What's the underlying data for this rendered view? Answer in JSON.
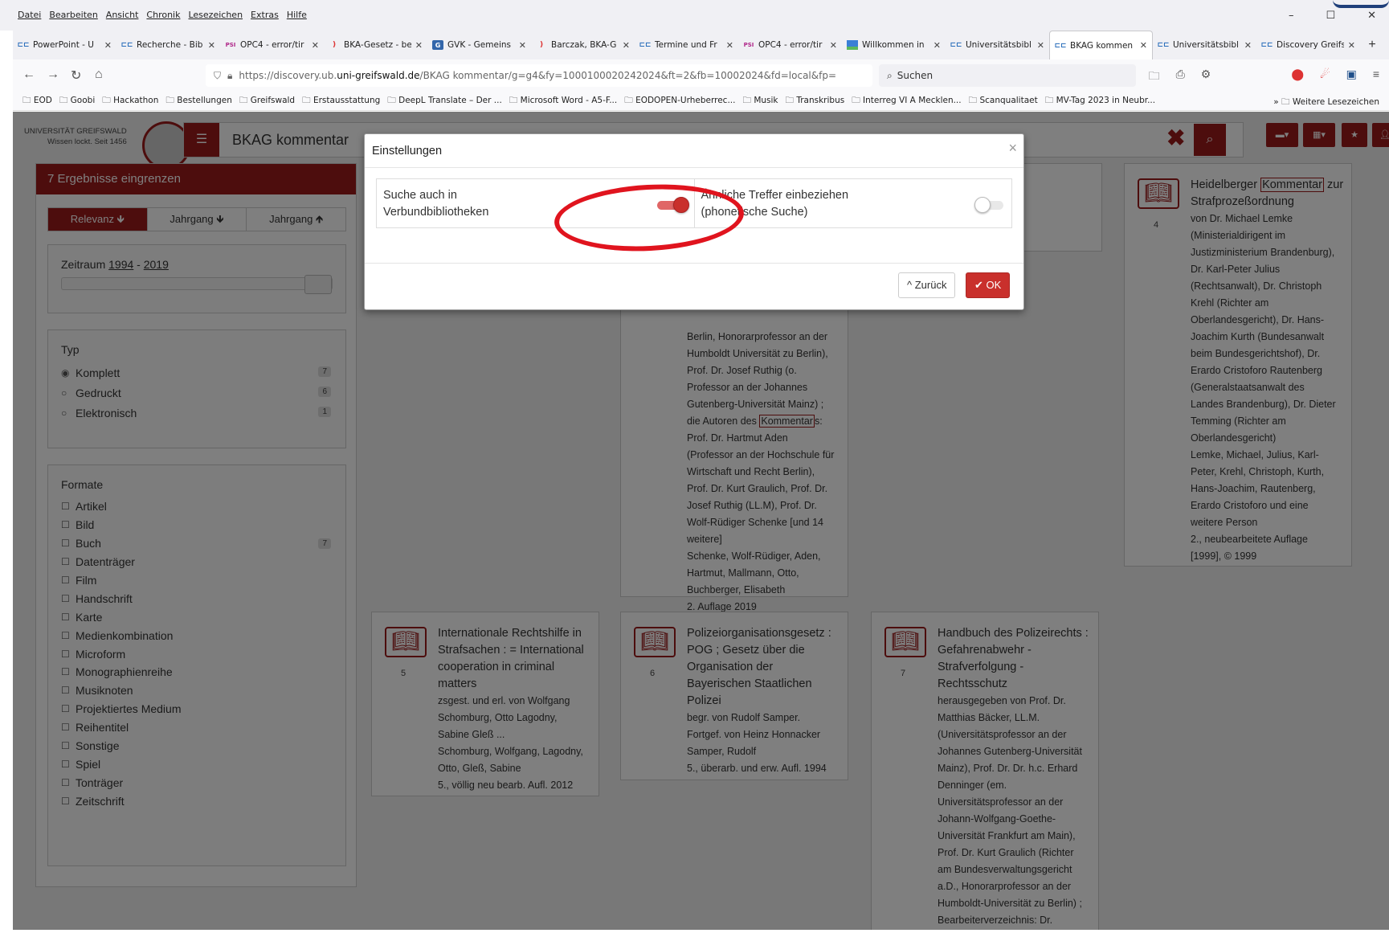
{
  "menu": [
    "Datei",
    "Bearbeiten",
    "Ansicht",
    "Chronik",
    "Lesezeichen",
    "Extras",
    "Hilfe"
  ],
  "tabs": [
    {
      "label": "PowerPoint - U",
      "icon": "ub-icon"
    },
    {
      "label": "Recherche - Bib",
      "icon": "ub-icon"
    },
    {
      "label": "OPC4 - error/tir",
      "icon": "psi-icon"
    },
    {
      "label": "BKA-Gesetz - be",
      "icon": "bookmark-red-icon"
    },
    {
      "label": "GVK - Gemeins",
      "icon": "gvk-icon"
    },
    {
      "label": "Barczak, BKA-G",
      "icon": "bookmark-red-icon"
    },
    {
      "label": "Termine und Fr",
      "icon": "ub-icon"
    },
    {
      "label": "OPC4 - error/tir",
      "icon": "psi-icon"
    },
    {
      "label": "Willkommen in",
      "icon": "mv-icon"
    },
    {
      "label": "Universitätsbibl",
      "icon": "ub-icon"
    },
    {
      "label": "BKAG kommen",
      "icon": "ub-icon"
    },
    {
      "label": "Universitätsbibl",
      "icon": "ub-icon"
    },
    {
      "label": "Discovery Greifs",
      "icon": "ub-icon"
    }
  ],
  "url": {
    "pre": "https://discovery.ub.",
    "domain": "uni-greifswald.de",
    "post": "/BKAG kommentar/g=g4&fy=1000100020242024&ft=2&fb=10002024&fd=local&fp="
  },
  "search_placeholder": "Suchen",
  "bookmarks": [
    "EOD",
    "Goobi",
    "Hackathon",
    "Bestellungen",
    "Greifswald",
    "Erstausstattung",
    "DeepL Translate – Der ...",
    "Microsoft Word - A5-F...",
    "EODOPEN-Urheberrec...",
    "Musik",
    "Transkribus",
    "Interreg VI A Mecklen...",
    "Scanqualitaet",
    "MV-Tag 2023 in Neubr..."
  ],
  "bookmarks_more": "Weitere Lesezeichen",
  "logo": {
    "line1": "UNIVERSITÄT GREIFSWALD",
    "line2": "Wissen lockt. Seit 1456"
  },
  "query": "BKAG kommentar",
  "sidebar": {
    "header": "7 Ergebnisse eingrenzen",
    "sort": [
      "Relevanz 🡻",
      "Jahrgang 🡻",
      "Jahrgang 🡹"
    ],
    "range_label_pre": "Zeitraum ",
    "range_from": "1994",
    "range_sep": " - ",
    "range_to": "2019",
    "type_title": "Typ",
    "types": [
      {
        "label": "Komplett",
        "count": "7"
      },
      {
        "label": "Gedruckt",
        "count": "6"
      },
      {
        "label": "Elektronisch",
        "count": "1"
      }
    ],
    "formats_title": "Formate",
    "formats": [
      {
        "label": "Artikel",
        "count": ""
      },
      {
        "label": "Bild",
        "count": ""
      },
      {
        "label": "Buch",
        "count": "7"
      },
      {
        "label": "Datenträger",
        "count": ""
      },
      {
        "label": "Film",
        "count": ""
      },
      {
        "label": "Handschrift",
        "count": ""
      },
      {
        "label": "Karte",
        "count": ""
      },
      {
        "label": "Medienkombination",
        "count": ""
      },
      {
        "label": "Microform",
        "count": ""
      },
      {
        "label": "Monographienreihe",
        "count": ""
      },
      {
        "label": "Musiknoten",
        "count": ""
      },
      {
        "label": "Projektiertes Medium",
        "count": ""
      },
      {
        "label": "Reihentitel",
        "count": ""
      },
      {
        "label": "Sonstige",
        "count": ""
      },
      {
        "label": "Spiel",
        "count": ""
      },
      {
        "label": "Tonträger",
        "count": ""
      },
      {
        "label": "Zeitschrift",
        "count": ""
      }
    ]
  },
  "results": {
    "r2_tail": [
      "Berlin, Honorarprofessor an der",
      "Humboldt Universität zu Berlin),",
      "Prof. Dr. Josef Ruthig (o.",
      "Professor an der Johannes",
      "Gutenberg-Universität Mainz) ;"
    ],
    "r2_mid_pre": "die Autoren des ",
    "r2_mid_hl": "Kommentar",
    "r2_mid_post": "s:",
    "r2_tail2": [
      "Prof. Dr. Hartmut Aden",
      "(Professor an der Hochschule für",
      "Wirtschaft und Recht Berlin),",
      "Prof. Dr. Kurt Graulich, Prof. Dr.",
      "Josef Ruthig (LL.M), Prof. Dr.",
      "Wolf-Rüdiger Schenke [und 14",
      "weitere]",
      "Schenke, Wolf-Rüdiger, Aden,",
      "Hartmut, Mallmann, Otto,",
      "Buchberger, Elisabeth",
      "2. Auflage 2019"
    ],
    "r4": {
      "num": "4",
      "title_pre": "Heidelberger ",
      "title_hl": "Kommentar",
      "title_post": " zur Strafprozeßordnung",
      "lines": [
        "von Dr. Michael Lemke",
        "(Ministerialdirigent im",
        "Justizministerium Brandenburg),",
        "Dr. Karl-Peter Julius",
        "(Rechtsanwalt), Dr. Christoph",
        "Krehl (Richter am",
        "Oberlandesgericht), Dr. Hans-",
        "Joachim Kurth (Bundesanwalt",
        "beim Bundesgerichtshof), Dr.",
        "Erardo Cristoforo Rautenberg",
        "(Generalstaatsanwalt des",
        "Landes Brandenburg), Dr. Dieter",
        "Temming (Richter am",
        "Oberlandesgericht)",
        "Lemke, Michael, Julius, Karl-",
        "Peter, Krehl, Christoph, Kurth,",
        "Hans-Joachim, Rautenberg,",
        "Erardo Cristoforo und eine",
        "weitere Person",
        "2., neubearbeitete Auflage",
        "[1999], © 1999"
      ]
    },
    "r5": {
      "num": "5",
      "title": [
        "Internationale Rechtshilfe in",
        "Strafsachen : = International",
        "cooperation in criminal",
        "matters"
      ],
      "lines": [
        "zsgest. und erl. von Wolfgang",
        "Schomburg, Otto Lagodny,",
        "Sabine Gleß ...",
        "Schomburg, Wolfgang, Lagodny,",
        "Otto, Gleß, Sabine",
        "5., völlig neu bearb. Aufl. 2012"
      ]
    },
    "r6": {
      "num": "6",
      "title": [
        "Polizeiorganisationsgesetz :",
        "POG ; Gesetz über die",
        "Organisation der",
        "Bayerischen Staatlichen",
        "Polizei"
      ],
      "lines": [
        "begr. von Rudolf Samper.",
        "Fortgef. von Heinz Honnacker",
        "Samper, Rudolf",
        "5., überarb. und erw. Aufl. 1994"
      ]
    },
    "r7": {
      "num": "7",
      "title": [
        "Handbuch des Polizeirechts :",
        "Gefahrenabwehr -",
        "Strafverfolgung -",
        "Rechtsschutz"
      ],
      "lines": [
        "herausgegeben von Prof. Dr.",
        "Matthias Bäcker, LL.M.",
        "(Universitätsprofessor an der",
        "Johannes Gutenberg-Universität",
        "Mainz), Prof. Dr. Dr. h.c. Erhard",
        "Denninger (em.",
        "Universitätsprofessor an der",
        "Johann-Wolfgang-Goethe-",
        "Universität Frankfurt am Main),",
        "Prof. Dr. Kurt Graulich (Richter",
        "am Bundesverwaltungsgericht",
        "a.D., Honorarprofessor an der",
        "Humboldt-Universität zu Berlin) ;",
        "Bearbeiterverzeichnis: Dr."
      ]
    }
  },
  "modal": {
    "title": "Einstellungen",
    "close": "×",
    "opt1": {
      "line1": "Suche auch in",
      "line2": "Verbundbibliotheken",
      "on": true
    },
    "opt2": {
      "line1": "Ähnliche Treffer einbeziehen",
      "line2": "(phonetische Suche)",
      "on": false
    },
    "back": "^ Zurück",
    "ok": "✔ OK"
  }
}
